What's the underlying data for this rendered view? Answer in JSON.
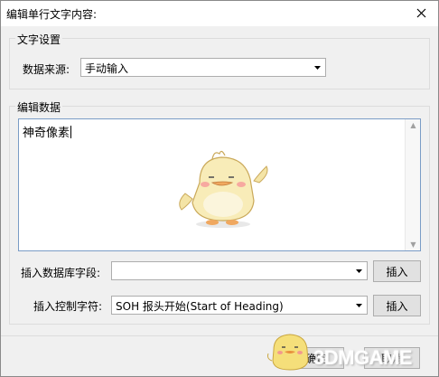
{
  "window": {
    "title": "编辑单行文字内容:"
  },
  "text_settings": {
    "group_label": "文字设置",
    "source_label": "数据来源:",
    "source_value": "手动输入"
  },
  "edit_data": {
    "group_label": "编辑数据",
    "content": "神奇像素"
  },
  "insert_db_field": {
    "label": "插入数据库字段:",
    "value": "",
    "button": "插入"
  },
  "insert_control_char": {
    "label": "插入控制字符:",
    "value": "SOH  报头开始(Start of Heading)",
    "button": "插入"
  },
  "footer": {
    "ok_label": "确定",
    "cancel_label": "取消"
  },
  "watermark": {
    "text": "3DMGAME"
  },
  "colors": {
    "accent_border": "#7a9cc6",
    "window_bg": "#f0f0f0"
  }
}
